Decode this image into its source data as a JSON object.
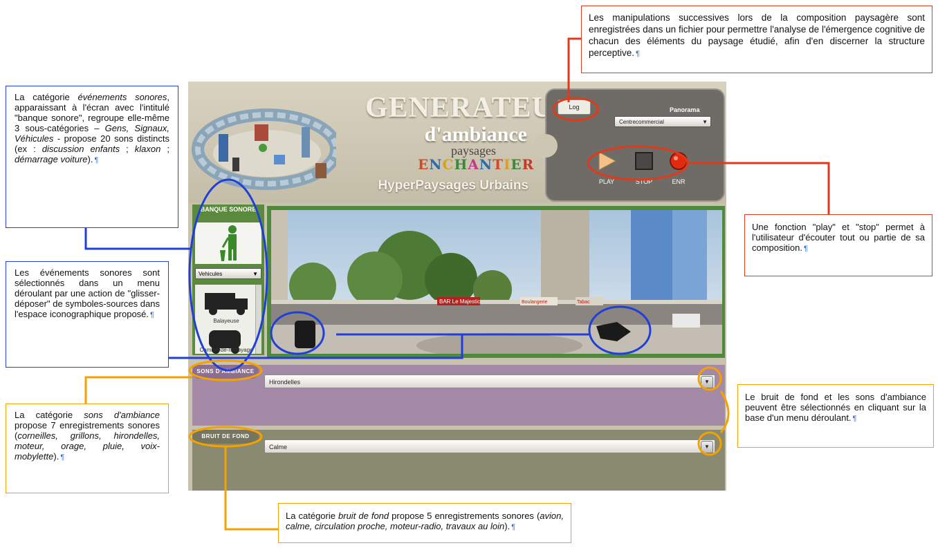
{
  "app": {
    "title_main": "GENERATEUR",
    "title_sub": "d'ambiance",
    "title_paysages": "paysages",
    "title_enchantier": "ENCHANTIER",
    "title_hyper": "HyperPaysages Urbains",
    "log_label": "Log",
    "panorama_label": "Panorama",
    "panorama_value": "Centrecommercial",
    "play_label": "PLAY",
    "stop_label": "STOP",
    "rec_label": "ENR",
    "banque": {
      "title": "BANQUE SONORE",
      "category": "Vehicules",
      "items": [
        "Balayeuse",
        "Camion-de-nettoyage"
      ]
    },
    "sons_ambiance": {
      "label": "SONS D'AMBIANCE",
      "value": "Hirondelles"
    },
    "bruit_fond": {
      "label": "BRUIT DE FOND",
      "value": "Calme"
    },
    "scene": {
      "shop_signs": [
        "BAR Le Majestic",
        "Boulangerie",
        "Tabac"
      ]
    }
  },
  "notes": {
    "log": "Les manipulations successives lors de la composition paysagère sont enregistrées dans un fichier pour permettre l'analyse de l'émergence cognitive de chacun des éléments du paysage étudié, afin d'en discerner la structure perceptive.",
    "evenements_1": "La catégorie ",
    "evenements_2": "événements sonores",
    "evenements_3": ", apparaissant à l'écran avec l'intitulé \"banque sonore\", regroupe elle-même 3 sous-catégories – ",
    "evenements_4": "Gens, Signaux, Véhicules",
    "evenements_5": " - propose 20 sons distincts (ex : ",
    "evenements_6": "discussion enfants",
    "evenements_7": " ; ",
    "evenements_8": "klaxon",
    "evenements_9": " ; ",
    "evenements_10": "démarrage voiture",
    "evenements_11": ").",
    "selection": "Les événements sonores sont sélectionnés dans un menu déroulant par une action de \"glisser-déposer\" de symboles-sources dans l'espace iconographique proposé.",
    "play": "Une fonction \"play\" et \"stop\" permet à l'utilisateur d'écouter tout ou partie de sa composition.",
    "ambiance_1": "La catégorie ",
    "ambiance_2": "sons d'ambiance",
    "ambiance_3": " propose 7 enregistrements sonores (",
    "ambiance_4": "corneilles, grillons, hirondelles, moteur, orage, pluie, voix-mobylette",
    "ambiance_5": ").",
    "fond_sel": "Le bruit de fond et les sons d'ambiance peuvent être sélectionnés en cliquant sur la base d'un menu déroulant.",
    "fond_1": "La catégorie ",
    "fond_2": "bruit de fond",
    "fond_3": " propose 5 enregistrements sonores (",
    "fond_4": "avion, calme, circulation proche, moteur-radio, travaux au loin",
    "fond_5": ").",
    "pilcrow": "¶"
  },
  "colors": {
    "blue": "#1f3fd8",
    "red": "#e03a1c",
    "orange": "#f5a100",
    "green": "#4f8a3a",
    "purple": "#a58aa7",
    "olive": "#8a8a70"
  }
}
